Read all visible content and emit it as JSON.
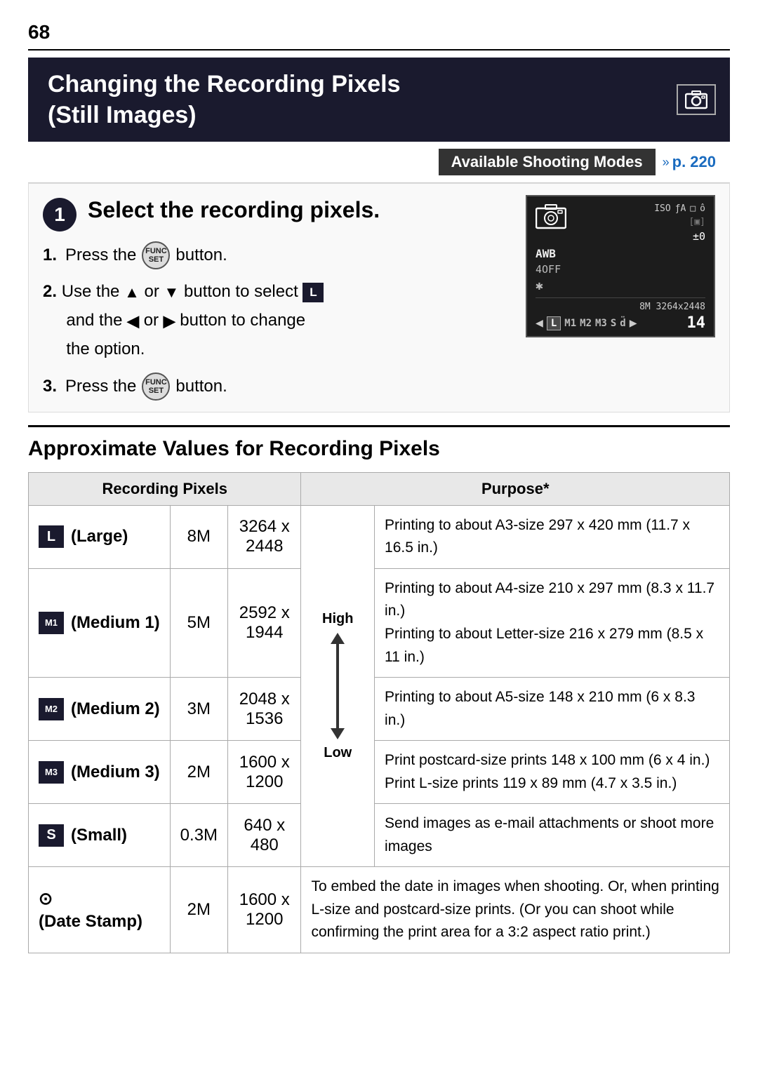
{
  "page": {
    "number": "68",
    "chapter_title_line1": "Changing the Recording Pixels",
    "chapter_title_line2": "(Still Images)",
    "camera_icon": "📷",
    "available_modes_label": "Available Shooting Modes",
    "available_modes_link": "p. 220",
    "step1_title": "Select the recording pixels.",
    "step1_instructions": [
      {
        "num": "1.",
        "text_before": "Press the",
        "button_label": "FUNC\nSET",
        "text_after": "button."
      },
      {
        "num": "2.",
        "text_before": "Use the",
        "arrows": "↑ or ↓",
        "text_middle": "button to select",
        "icon": "L",
        "text_and": "and the",
        "arrows2": "← or →",
        "text_end": "button to change the option."
      },
      {
        "num": "3.",
        "text_before": "Press the",
        "button_label": "FUNC\nSET",
        "text_after": "button."
      }
    ],
    "camera_preview": {
      "top_status": "ISO ƒA  □ ô",
      "pm_value": "±0",
      "awb": "AWB",
      "af": "4OFF",
      "star": "✱",
      "resolution_label": "8M 3264x2448",
      "modes": [
        "L",
        "M1",
        "M2",
        "M3",
        "S",
        "d̈"
      ],
      "active_mode": "L",
      "count": "14"
    },
    "approx_section_title": "Approximate Values for Recording Pixels",
    "table_headers": {
      "recording_pixels": "Recording Pixels",
      "purpose": "Purpose*"
    },
    "table_rows": [
      {
        "icon": "L",
        "name": "(Large)",
        "mp": "8M",
        "resolution": "3264 x 2448",
        "quality": "High",
        "purpose": "Printing to about A3-size 297 x 420 mm (11.7 x 16.5 in.)"
      },
      {
        "icon": "M1",
        "name": "(Medium 1)",
        "mp": "5M",
        "resolution": "2592 x 1944",
        "quality": "",
        "purpose": "Printing to about A4-size 210 x 297 mm (8.3 x 11.7 in.)\nPrinting to about Letter-size 216 x 279 mm (8.5 x 11 in.)"
      },
      {
        "icon": "M2",
        "name": "(Medium 2)",
        "mp": "3M",
        "resolution": "2048 x 1536",
        "quality": "",
        "purpose": "Printing to about A5-size 148 x 210 mm (6 x 8.3 in.)"
      },
      {
        "icon": "M3",
        "name": "(Medium 3)",
        "mp": "2M",
        "resolution": "1600 x 1200",
        "quality": "",
        "purpose": "Print postcard-size prints 148 x 100 mm (6 x 4 in.)\nPrint L-size prints 119 x 89 mm (4.7 x 3.5 in.)"
      },
      {
        "icon": "S",
        "name": "(Small)",
        "mp": "0.3M",
        "resolution": "640 x 480",
        "quality": "Low",
        "purpose": "Send images as e-mail attachments or shoot more images"
      },
      {
        "icon": "DS",
        "name": "(Date Stamp)",
        "mp": "2M",
        "resolution": "1600 x 1200",
        "quality": "",
        "purpose": "To embed the date in images when shooting. Or, when printing L-size and postcard-size prints. (Or you can shoot while confirming the print area for a 3:2 aspect ratio print.)"
      }
    ]
  }
}
